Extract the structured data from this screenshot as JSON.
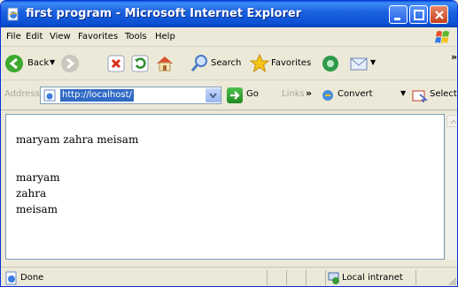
{
  "window": {
    "title": "first program - Microsoft Internet Explorer"
  },
  "menu": [
    "File",
    "Edit",
    "View",
    "Favorites",
    "Tools",
    "Help"
  ],
  "toolbar": {
    "back_label": "Back",
    "search_label": "Search",
    "favorites_label": "Favorites",
    "overflow": "»"
  },
  "address": {
    "label": "Address",
    "url": "http://localhost/",
    "go_label": "Go",
    "links_label": "Links",
    "links_overflow": "»",
    "convert_label": "Convert",
    "select_label": "Select"
  },
  "page": {
    "line1": "maryam zahra meisam",
    "items": [
      "maryam",
      "zahra",
      "meisam"
    ]
  },
  "status": {
    "text": "Done",
    "zone": "Local intranet"
  },
  "colors": {
    "titlebar": "#0b4fd3",
    "chrome": "#ece9d8",
    "selection": "#316ac5"
  }
}
